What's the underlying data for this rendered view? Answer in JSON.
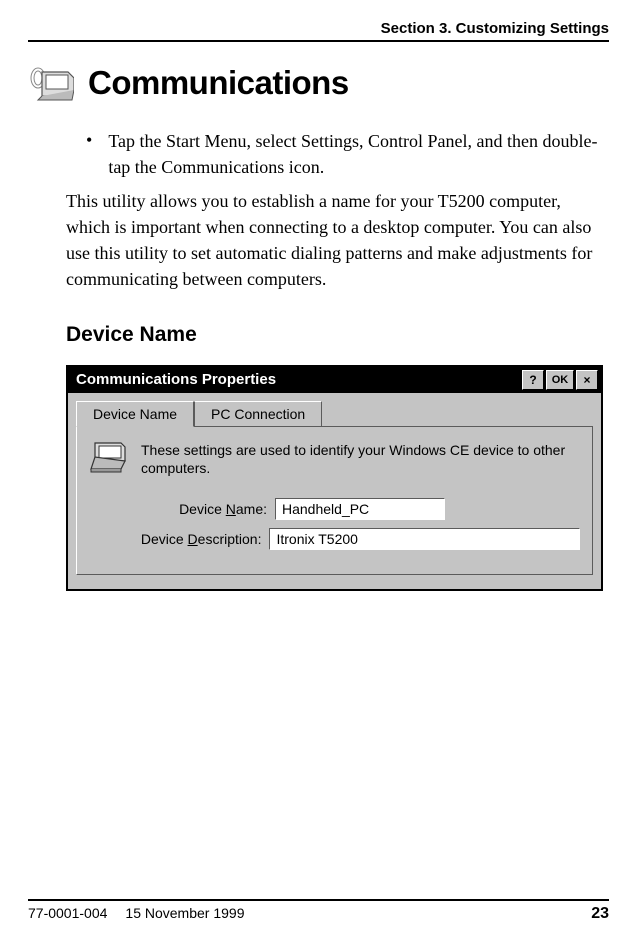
{
  "header": {
    "section": "Section 3. Customizing Settings"
  },
  "title": "Communications",
  "bullet": "Tap the Start Menu, select Settings, Control Panel, and then double-tap the Communications icon.",
  "paragraph": "This utility allows you to establish a name for your T5200 computer, which is important when connecting to a desktop computer. You can also use this utility to set automatic dialing patterns and make adjustments for communicating between computers.",
  "subheading": "Device Name",
  "window": {
    "title": "Communications Properties",
    "help": "?",
    "ok": "OK",
    "close": "×",
    "tabs": {
      "active": "Device Name",
      "inactive": "PC Connection"
    },
    "info": "These settings are used to identify your Windows CE device to other computers.",
    "name_label_prefix": "Device ",
    "name_label_ul": "N",
    "name_label_suffix": "ame:",
    "name_value": "Handheld_PC",
    "desc_label_prefix": "Device ",
    "desc_label_ul": "D",
    "desc_label_suffix": "escription:",
    "desc_value": "Itronix T5200"
  },
  "footer": {
    "docnum": "77-0001-004",
    "date": "15 November 1999",
    "page": "23"
  }
}
